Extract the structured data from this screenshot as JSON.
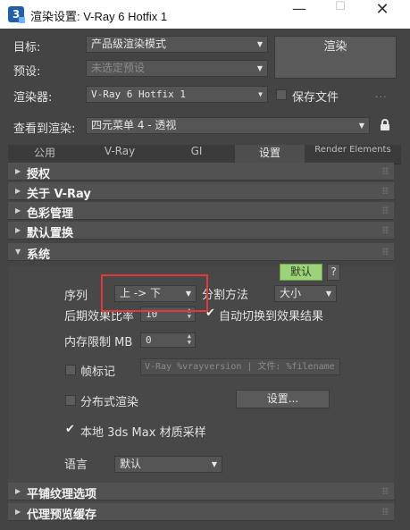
{
  "window": {
    "title": "渲染设置: V-Ray 6 Hotfix 1",
    "app_icon_glyph": "3",
    "controls": {
      "minimize": "—",
      "maximize": "☐",
      "close": "✕"
    }
  },
  "header": {
    "target_label": "目标:",
    "target_value": "产品级渲染模式",
    "preset_label": "预设:",
    "preset_value": "未选定预设",
    "renderer_label": "渲染器:",
    "renderer_value": "V-Ray 6 Hotfix 1",
    "save_file_label": "保存文件",
    "more_dots": "...",
    "view_label": "查看到渲染:",
    "view_value": "四元菜单 4 - 透视",
    "render_button": "渲染"
  },
  "tabs": [
    {
      "label": "公用"
    },
    {
      "label": "V-Ray"
    },
    {
      "label": "GI"
    },
    {
      "label": "设置"
    },
    {
      "label": "Render Elements"
    }
  ],
  "active_tab": "设置",
  "rollouts": {
    "license": "授权",
    "about": "关于 V-Ray",
    "color_mgmt": "色彩管理",
    "default_displace": "默认置换",
    "system": "系统",
    "tiled_texture": "平铺纹理选项",
    "proxy_cache": "代理预览缓存"
  },
  "system": {
    "default_button": "默认",
    "help_button": "?",
    "sequence_label": "序列",
    "sequence_value": "上 -> 下",
    "split_method_label": "分割方法",
    "split_method_value": "大小",
    "post_effects_label": "后期效果比率",
    "post_effects_value": "10",
    "auto_switch_label": "自动切换到效果结果",
    "auto_switch_checked": true,
    "mem_limit_label": "内存限制 MB",
    "mem_limit_value": "0",
    "frame_stamp_label": "帧标记",
    "frame_stamp_checked": false,
    "frame_stamp_text": "V-Ray %vrayversion | 文件: %filename",
    "distributed_label": "分布式渲染",
    "distributed_checked": false,
    "distributed_settings_button": "设置...",
    "local_material_label": "本地 3ds Max 材质采样",
    "local_material_checked": true,
    "language_label": "语言",
    "language_value": "默认"
  },
  "colors": {
    "panel_bg": "#444444",
    "default_button": "#9bd27a",
    "highlight_box": "#e23a3a"
  }
}
